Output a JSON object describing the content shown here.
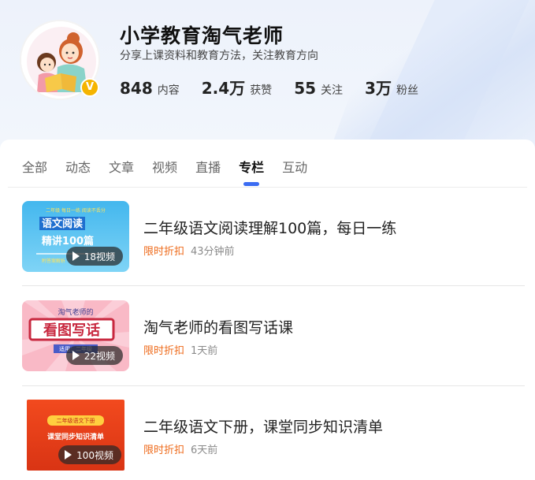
{
  "profile": {
    "name": "小学教育淘气老师",
    "description": "分享上课资料和教育方法，关注教育方向",
    "verify_mark": "V",
    "stats": [
      {
        "value": "848",
        "label": "内容"
      },
      {
        "value": "2.4万",
        "label": "获赞"
      },
      {
        "value": "55",
        "label": "关注"
      },
      {
        "value": "3万",
        "label": "粉丝"
      }
    ]
  },
  "tabs": [
    {
      "label": "全部",
      "active": false
    },
    {
      "label": "动态",
      "active": false
    },
    {
      "label": "文章",
      "active": false
    },
    {
      "label": "视频",
      "active": false
    },
    {
      "label": "直播",
      "active": false
    },
    {
      "label": "专栏",
      "active": true
    },
    {
      "label": "互动",
      "active": false
    }
  ],
  "items": [
    {
      "title": "二年级语文阅读理解100篇，每日一练",
      "discount": "限时折扣",
      "time": "43分钟前",
      "video_count": "18视频",
      "thumb": {
        "top_text": "二年级 每日一练 阅读不丢分",
        "line1": "语文阅读",
        "line2": "精讲100篇",
        "bottom_text": "附答案解析"
      }
    },
    {
      "title": "淘气老师的看图写话课",
      "discount": "限时折扣",
      "time": "1天前",
      "video_count": "22视频",
      "thumb": {
        "top_text": "淘气老师的",
        "line1": "看图写话",
        "bottom_text": "适用：二年级"
      }
    },
    {
      "title": "二年级语文下册，课堂同步知识清单",
      "discount": "限时折扣",
      "time": "6天前",
      "video_count": "100视频",
      "thumb": {
        "top_text": "二年级语文下册",
        "line1": "课堂同步知识清单"
      }
    }
  ],
  "colors": {
    "accent": "#3b6cf2",
    "discount": "#ee6a1a",
    "badge": "#f5b400"
  }
}
